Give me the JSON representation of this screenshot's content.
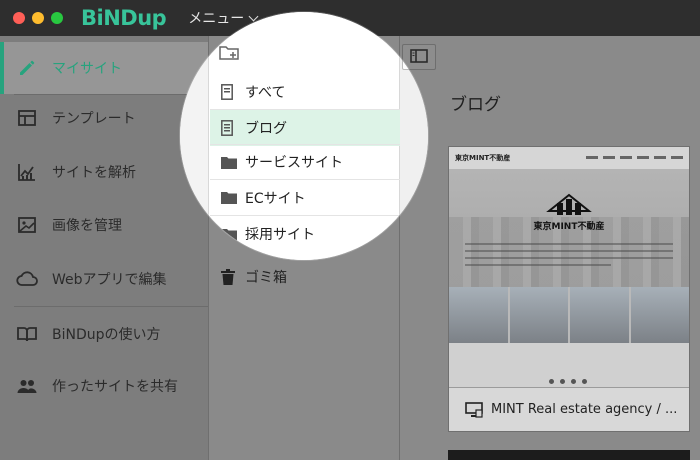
{
  "titlebar": {
    "logo": "BiNDup",
    "menu_label": "メニュー",
    "traffic_colors": [
      "#ff5f57",
      "#febc2e",
      "#28c840"
    ]
  },
  "sidebar": {
    "items": [
      {
        "label": "マイサイト",
        "icon": "pencil-icon",
        "active": true
      },
      {
        "label": "テンプレート",
        "icon": "template-icon"
      },
      {
        "label": "サイトを解析",
        "icon": "chart-icon"
      },
      {
        "label": "画像を管理",
        "icon": "image-icon"
      },
      {
        "label": "Webアプリで編集",
        "icon": "cloud-icon"
      },
      {
        "label": "BiNDupの使い方",
        "icon": "book-icon"
      },
      {
        "label": "作ったサイトを共有",
        "icon": "people-icon"
      }
    ]
  },
  "folders": {
    "add_icon": "folder-add-icon",
    "items": [
      {
        "label": "すべて",
        "icon": "document-icon"
      },
      {
        "label": "ブログ",
        "icon": "document-icon",
        "active": true
      },
      {
        "label": "サービスサイト",
        "icon": "folder-icon"
      },
      {
        "label": "ECサイト",
        "icon": "folder-icon"
      },
      {
        "label": "採用サイト",
        "icon": "folder-icon"
      }
    ],
    "trash": {
      "label": "ゴミ箱",
      "icon": "trash-icon"
    }
  },
  "main": {
    "section_title": "ブログ",
    "cards": [
      {
        "title": "MINT Real estate agency / ...",
        "icon": "desktop-icon",
        "thumb_brand": "東京MINT不動産",
        "thumb_title": "東京MINT不動産"
      }
    ]
  },
  "colors": {
    "accent": "#27a37e",
    "active_row": "#ddf3e7",
    "titlebar": "#2e2e2e"
  }
}
